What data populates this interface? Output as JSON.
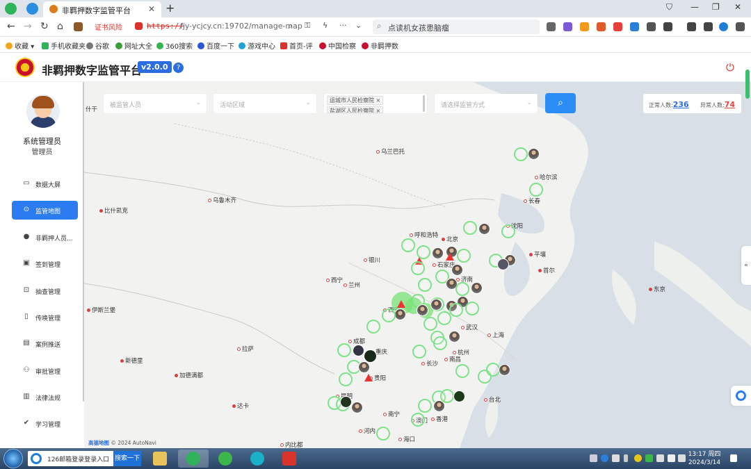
{
  "browser": {
    "tab_title": "非羁押数字监管平台",
    "cert_warning": "证书风险",
    "protocol": "https://",
    "url": "fjy-ycjcy.cn:19702/manage-map",
    "search_text": "点读机女孩患脑瘤"
  },
  "bookmarks": [
    "收藏",
    "手机收藏夹",
    "谷歌",
    "网址大全",
    "360搜索",
    "百度一下",
    "游戏中心",
    "首页-评",
    "中国检察",
    "非羁押数"
  ],
  "header": {
    "title": "非羁押数字监管平台",
    "version": "v2.0.0",
    "help": "?"
  },
  "user": {
    "name": "系统管理员",
    "role": "管理员"
  },
  "menu": [
    {
      "label": "数据大屏",
      "icon": "monitor-icon"
    },
    {
      "label": "监管地图",
      "icon": "map-pin-icon",
      "active": true
    },
    {
      "label": "非羁押人员...",
      "icon": "person-icon"
    },
    {
      "label": "签到管理",
      "icon": "calendar-icon"
    },
    {
      "label": "抽查管理",
      "icon": "inbox-icon"
    },
    {
      "label": "传唤管理",
      "icon": "document-icon"
    },
    {
      "label": "案例推送",
      "icon": "clipboard-icon"
    },
    {
      "label": "审批管理",
      "icon": "approve-icon"
    },
    {
      "label": "法律法规",
      "icon": "law-book-icon"
    },
    {
      "label": "学习管理",
      "icon": "check-circle-icon"
    }
  ],
  "filters": {
    "person_placeholder": "被监管人员",
    "area_placeholder": "活动区域",
    "org_tags": [
      "运城市人民检察院",
      "盐湖区人民检察院"
    ],
    "method_placeholder": "请选择监管方式"
  },
  "stats": {
    "normal_label": "正常人数:",
    "normal_value": "236",
    "abnormal_label": "异常人数:",
    "abnormal_value": "74"
  },
  "map": {
    "cities": [
      {
        "name": "乌兰巴托"
      },
      {
        "name": "哈尔滨"
      },
      {
        "name": "长春"
      },
      {
        "name": "沈阳"
      },
      {
        "name": "呼和浩特"
      },
      {
        "name": "北京"
      },
      {
        "name": "石家庄"
      },
      {
        "name": "济南"
      },
      {
        "name": "平壤"
      },
      {
        "name": "首尔"
      },
      {
        "name": "东京"
      },
      {
        "name": "银川"
      },
      {
        "name": "兰州"
      },
      {
        "name": "西宁"
      },
      {
        "name": "乌鲁木齐"
      },
      {
        "name": "比什凯克"
      },
      {
        "name": "伊斯兰堡"
      },
      {
        "name": "拉萨"
      },
      {
        "name": "新德里"
      },
      {
        "name": "加德满都"
      },
      {
        "name": "成都"
      },
      {
        "name": "重庆"
      },
      {
        "name": "武汉"
      },
      {
        "name": "南京"
      },
      {
        "name": "上海"
      },
      {
        "name": "杭州"
      },
      {
        "name": "长沙"
      },
      {
        "name": "南昌"
      },
      {
        "name": "贵阳"
      },
      {
        "name": "昆明"
      },
      {
        "name": "南宁"
      },
      {
        "name": "香港"
      },
      {
        "name": "澳门"
      },
      {
        "name": "台北"
      },
      {
        "name": "达卡"
      },
      {
        "name": "河内"
      },
      {
        "name": "海口"
      },
      {
        "name": "内比都"
      },
      {
        "name": "西安"
      },
      {
        "name": "什干"
      }
    ],
    "attribution": "高德地图",
    "copyright": "© 2024 AutoNavi"
  },
  "taskbar": {
    "search_text": "126邮箱登录登录入口",
    "search_button": "搜索一下",
    "time": "13:17 周四",
    "date": "2024/3/14"
  }
}
